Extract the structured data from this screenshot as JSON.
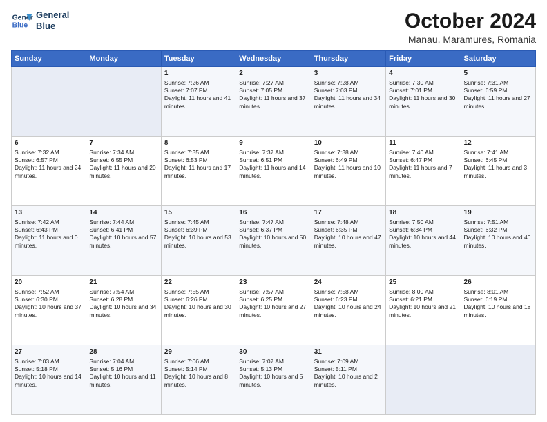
{
  "header": {
    "logo_line1": "General",
    "logo_line2": "Blue",
    "title": "October 2024",
    "subtitle": "Manau, Maramures, Romania"
  },
  "weekdays": [
    "Sunday",
    "Monday",
    "Tuesday",
    "Wednesday",
    "Thursday",
    "Friday",
    "Saturday"
  ],
  "rows": [
    [
      {
        "day": "",
        "sunrise": "",
        "sunset": "",
        "daylight": ""
      },
      {
        "day": "",
        "sunrise": "",
        "sunset": "",
        "daylight": ""
      },
      {
        "day": "1",
        "sunrise": "Sunrise: 7:26 AM",
        "sunset": "Sunset: 7:07 PM",
        "daylight": "Daylight: 11 hours and 41 minutes."
      },
      {
        "day": "2",
        "sunrise": "Sunrise: 7:27 AM",
        "sunset": "Sunset: 7:05 PM",
        "daylight": "Daylight: 11 hours and 37 minutes."
      },
      {
        "day": "3",
        "sunrise": "Sunrise: 7:28 AM",
        "sunset": "Sunset: 7:03 PM",
        "daylight": "Daylight: 11 hours and 34 minutes."
      },
      {
        "day": "4",
        "sunrise": "Sunrise: 7:30 AM",
        "sunset": "Sunset: 7:01 PM",
        "daylight": "Daylight: 11 hours and 30 minutes."
      },
      {
        "day": "5",
        "sunrise": "Sunrise: 7:31 AM",
        "sunset": "Sunset: 6:59 PM",
        "daylight": "Daylight: 11 hours and 27 minutes."
      }
    ],
    [
      {
        "day": "6",
        "sunrise": "Sunrise: 7:32 AM",
        "sunset": "Sunset: 6:57 PM",
        "daylight": "Daylight: 11 hours and 24 minutes."
      },
      {
        "day": "7",
        "sunrise": "Sunrise: 7:34 AM",
        "sunset": "Sunset: 6:55 PM",
        "daylight": "Daylight: 11 hours and 20 minutes."
      },
      {
        "day": "8",
        "sunrise": "Sunrise: 7:35 AM",
        "sunset": "Sunset: 6:53 PM",
        "daylight": "Daylight: 11 hours and 17 minutes."
      },
      {
        "day": "9",
        "sunrise": "Sunrise: 7:37 AM",
        "sunset": "Sunset: 6:51 PM",
        "daylight": "Daylight: 11 hours and 14 minutes."
      },
      {
        "day": "10",
        "sunrise": "Sunrise: 7:38 AM",
        "sunset": "Sunset: 6:49 PM",
        "daylight": "Daylight: 11 hours and 10 minutes."
      },
      {
        "day": "11",
        "sunrise": "Sunrise: 7:40 AM",
        "sunset": "Sunset: 6:47 PM",
        "daylight": "Daylight: 11 hours and 7 minutes."
      },
      {
        "day": "12",
        "sunrise": "Sunrise: 7:41 AM",
        "sunset": "Sunset: 6:45 PM",
        "daylight": "Daylight: 11 hours and 3 minutes."
      }
    ],
    [
      {
        "day": "13",
        "sunrise": "Sunrise: 7:42 AM",
        "sunset": "Sunset: 6:43 PM",
        "daylight": "Daylight: 11 hours and 0 minutes."
      },
      {
        "day": "14",
        "sunrise": "Sunrise: 7:44 AM",
        "sunset": "Sunset: 6:41 PM",
        "daylight": "Daylight: 10 hours and 57 minutes."
      },
      {
        "day": "15",
        "sunrise": "Sunrise: 7:45 AM",
        "sunset": "Sunset: 6:39 PM",
        "daylight": "Daylight: 10 hours and 53 minutes."
      },
      {
        "day": "16",
        "sunrise": "Sunrise: 7:47 AM",
        "sunset": "Sunset: 6:37 PM",
        "daylight": "Daylight: 10 hours and 50 minutes."
      },
      {
        "day": "17",
        "sunrise": "Sunrise: 7:48 AM",
        "sunset": "Sunset: 6:35 PM",
        "daylight": "Daylight: 10 hours and 47 minutes."
      },
      {
        "day": "18",
        "sunrise": "Sunrise: 7:50 AM",
        "sunset": "Sunset: 6:34 PM",
        "daylight": "Daylight: 10 hours and 44 minutes."
      },
      {
        "day": "19",
        "sunrise": "Sunrise: 7:51 AM",
        "sunset": "Sunset: 6:32 PM",
        "daylight": "Daylight: 10 hours and 40 minutes."
      }
    ],
    [
      {
        "day": "20",
        "sunrise": "Sunrise: 7:52 AM",
        "sunset": "Sunset: 6:30 PM",
        "daylight": "Daylight: 10 hours and 37 minutes."
      },
      {
        "day": "21",
        "sunrise": "Sunrise: 7:54 AM",
        "sunset": "Sunset: 6:28 PM",
        "daylight": "Daylight: 10 hours and 34 minutes."
      },
      {
        "day": "22",
        "sunrise": "Sunrise: 7:55 AM",
        "sunset": "Sunset: 6:26 PM",
        "daylight": "Daylight: 10 hours and 30 minutes."
      },
      {
        "day": "23",
        "sunrise": "Sunrise: 7:57 AM",
        "sunset": "Sunset: 6:25 PM",
        "daylight": "Daylight: 10 hours and 27 minutes."
      },
      {
        "day": "24",
        "sunrise": "Sunrise: 7:58 AM",
        "sunset": "Sunset: 6:23 PM",
        "daylight": "Daylight: 10 hours and 24 minutes."
      },
      {
        "day": "25",
        "sunrise": "Sunrise: 8:00 AM",
        "sunset": "Sunset: 6:21 PM",
        "daylight": "Daylight: 10 hours and 21 minutes."
      },
      {
        "day": "26",
        "sunrise": "Sunrise: 8:01 AM",
        "sunset": "Sunset: 6:19 PM",
        "daylight": "Daylight: 10 hours and 18 minutes."
      }
    ],
    [
      {
        "day": "27",
        "sunrise": "Sunrise: 7:03 AM",
        "sunset": "Sunset: 5:18 PM",
        "daylight": "Daylight: 10 hours and 14 minutes."
      },
      {
        "day": "28",
        "sunrise": "Sunrise: 7:04 AM",
        "sunset": "Sunset: 5:16 PM",
        "daylight": "Daylight: 10 hours and 11 minutes."
      },
      {
        "day": "29",
        "sunrise": "Sunrise: 7:06 AM",
        "sunset": "Sunset: 5:14 PM",
        "daylight": "Daylight: 10 hours and 8 minutes."
      },
      {
        "day": "30",
        "sunrise": "Sunrise: 7:07 AM",
        "sunset": "Sunset: 5:13 PM",
        "daylight": "Daylight: 10 hours and 5 minutes."
      },
      {
        "day": "31",
        "sunrise": "Sunrise: 7:09 AM",
        "sunset": "Sunset: 5:11 PM",
        "daylight": "Daylight: 10 hours and 2 minutes."
      },
      {
        "day": "",
        "sunrise": "",
        "sunset": "",
        "daylight": ""
      },
      {
        "day": "",
        "sunrise": "",
        "sunset": "",
        "daylight": ""
      }
    ]
  ]
}
